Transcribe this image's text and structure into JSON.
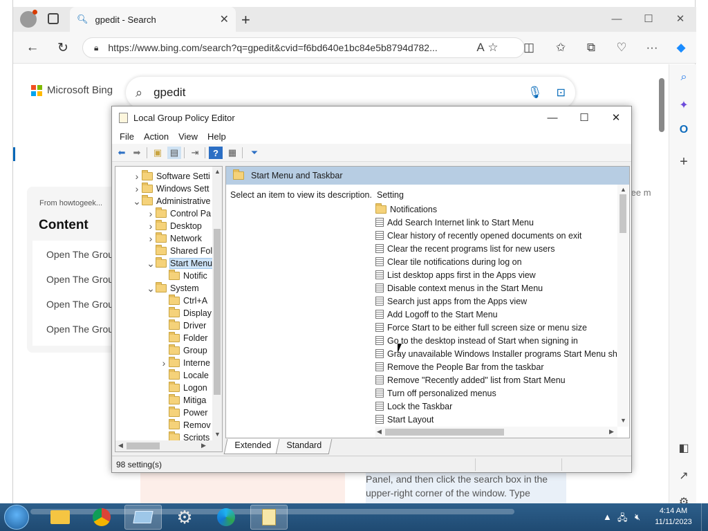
{
  "browser": {
    "tab_title": "gpedit - Search",
    "tab_close": "✕",
    "new_tab": "+",
    "url": "https://www.bing.com/search?q=gpedit&cvid=f6bd640e1bc84e5b8794d782...",
    "win_minimize": "—",
    "win_maximize": "☐",
    "win_close": "✕"
  },
  "bing": {
    "logo_text": "Microsoft Bing",
    "query": "gpedit",
    "from_text": "From howtogeek...",
    "content_heading": "Content",
    "content_items": [
      "Open The Grou...",
      "Open The Grou...",
      "Open The Grou...",
      "Open The Grou..."
    ],
    "see_more": "See m",
    "snippet": "Panel, and then click the search box in the upper-right corner of the window. Type"
  },
  "gpe": {
    "title": "Local Group Policy Editor",
    "menu": [
      "File",
      "Action",
      "View",
      "Help"
    ],
    "tree": [
      {
        "label": "Software Setti",
        "indent": 1,
        "exp": ">"
      },
      {
        "label": "Windows Sett",
        "indent": 1,
        "exp": ">"
      },
      {
        "label": "Administrative",
        "indent": 1,
        "exp": "v"
      },
      {
        "label": "Control Pa",
        "indent": 2,
        "exp": ">"
      },
      {
        "label": "Desktop",
        "indent": 2,
        "exp": ">"
      },
      {
        "label": "Network",
        "indent": 2,
        "exp": ">"
      },
      {
        "label": "Shared Fol",
        "indent": 2,
        "exp": ""
      },
      {
        "label": "Start Menu",
        "indent": 2,
        "exp": "v",
        "selected": true
      },
      {
        "label": "Notific",
        "indent": 3,
        "exp": ""
      },
      {
        "label": "System",
        "indent": 2,
        "exp": "v"
      },
      {
        "label": "Ctrl+A",
        "indent": 3,
        "exp": ""
      },
      {
        "label": "Display",
        "indent": 3,
        "exp": ""
      },
      {
        "label": "Driver",
        "indent": 3,
        "exp": ""
      },
      {
        "label": "Folder",
        "indent": 3,
        "exp": ""
      },
      {
        "label": "Group",
        "indent": 3,
        "exp": ""
      },
      {
        "label": "Interne",
        "indent": 3,
        "exp": ">"
      },
      {
        "label": "Locale",
        "indent": 3,
        "exp": ""
      },
      {
        "label": "Logon",
        "indent": 3,
        "exp": ""
      },
      {
        "label": "Mitiga",
        "indent": 3,
        "exp": ""
      },
      {
        "label": "Power",
        "indent": 3,
        "exp": ""
      },
      {
        "label": "Remov",
        "indent": 3,
        "exp": ""
      },
      {
        "label": "Scripts",
        "indent": 3,
        "exp": ""
      }
    ],
    "right_header": "Start Menu and Taskbar",
    "description": "Select an item to view its description.",
    "setting_column": "Setting",
    "settings": [
      {
        "label": "Notifications",
        "folder": true
      },
      {
        "label": "Add Search Internet link to Start Menu"
      },
      {
        "label": "Clear history of recently opened documents on exit"
      },
      {
        "label": "Clear the recent programs list for new users"
      },
      {
        "label": "Clear tile notifications during log on"
      },
      {
        "label": "List desktop apps first in the Apps view"
      },
      {
        "label": "Disable context menus in the Start Menu"
      },
      {
        "label": "Search just apps from the Apps view"
      },
      {
        "label": "Add Logoff to the Start Menu"
      },
      {
        "label": "Force Start to be either full screen size or menu size"
      },
      {
        "label": "Go to the desktop instead of Start when signing in"
      },
      {
        "label": "Gray unavailable Windows Installer programs Start Menu sh..."
      },
      {
        "label": "Remove the People Bar from the taskbar"
      },
      {
        "label": "Remove \"Recently added\" list from Start Menu"
      },
      {
        "label": "Turn off personalized menus"
      },
      {
        "label": "Lock the Taskbar"
      },
      {
        "label": "Start Layout"
      }
    ],
    "tab_extended": "Extended",
    "tab_standard": "Standard",
    "status": "98 setting(s)"
  },
  "taskbar": {
    "time": "4:14 AM",
    "date": "11/11/2023"
  },
  "colors": {
    "accent": "#0078d4",
    "header_blue": "#b7cde3",
    "taskbar": "#2d5f8b"
  }
}
